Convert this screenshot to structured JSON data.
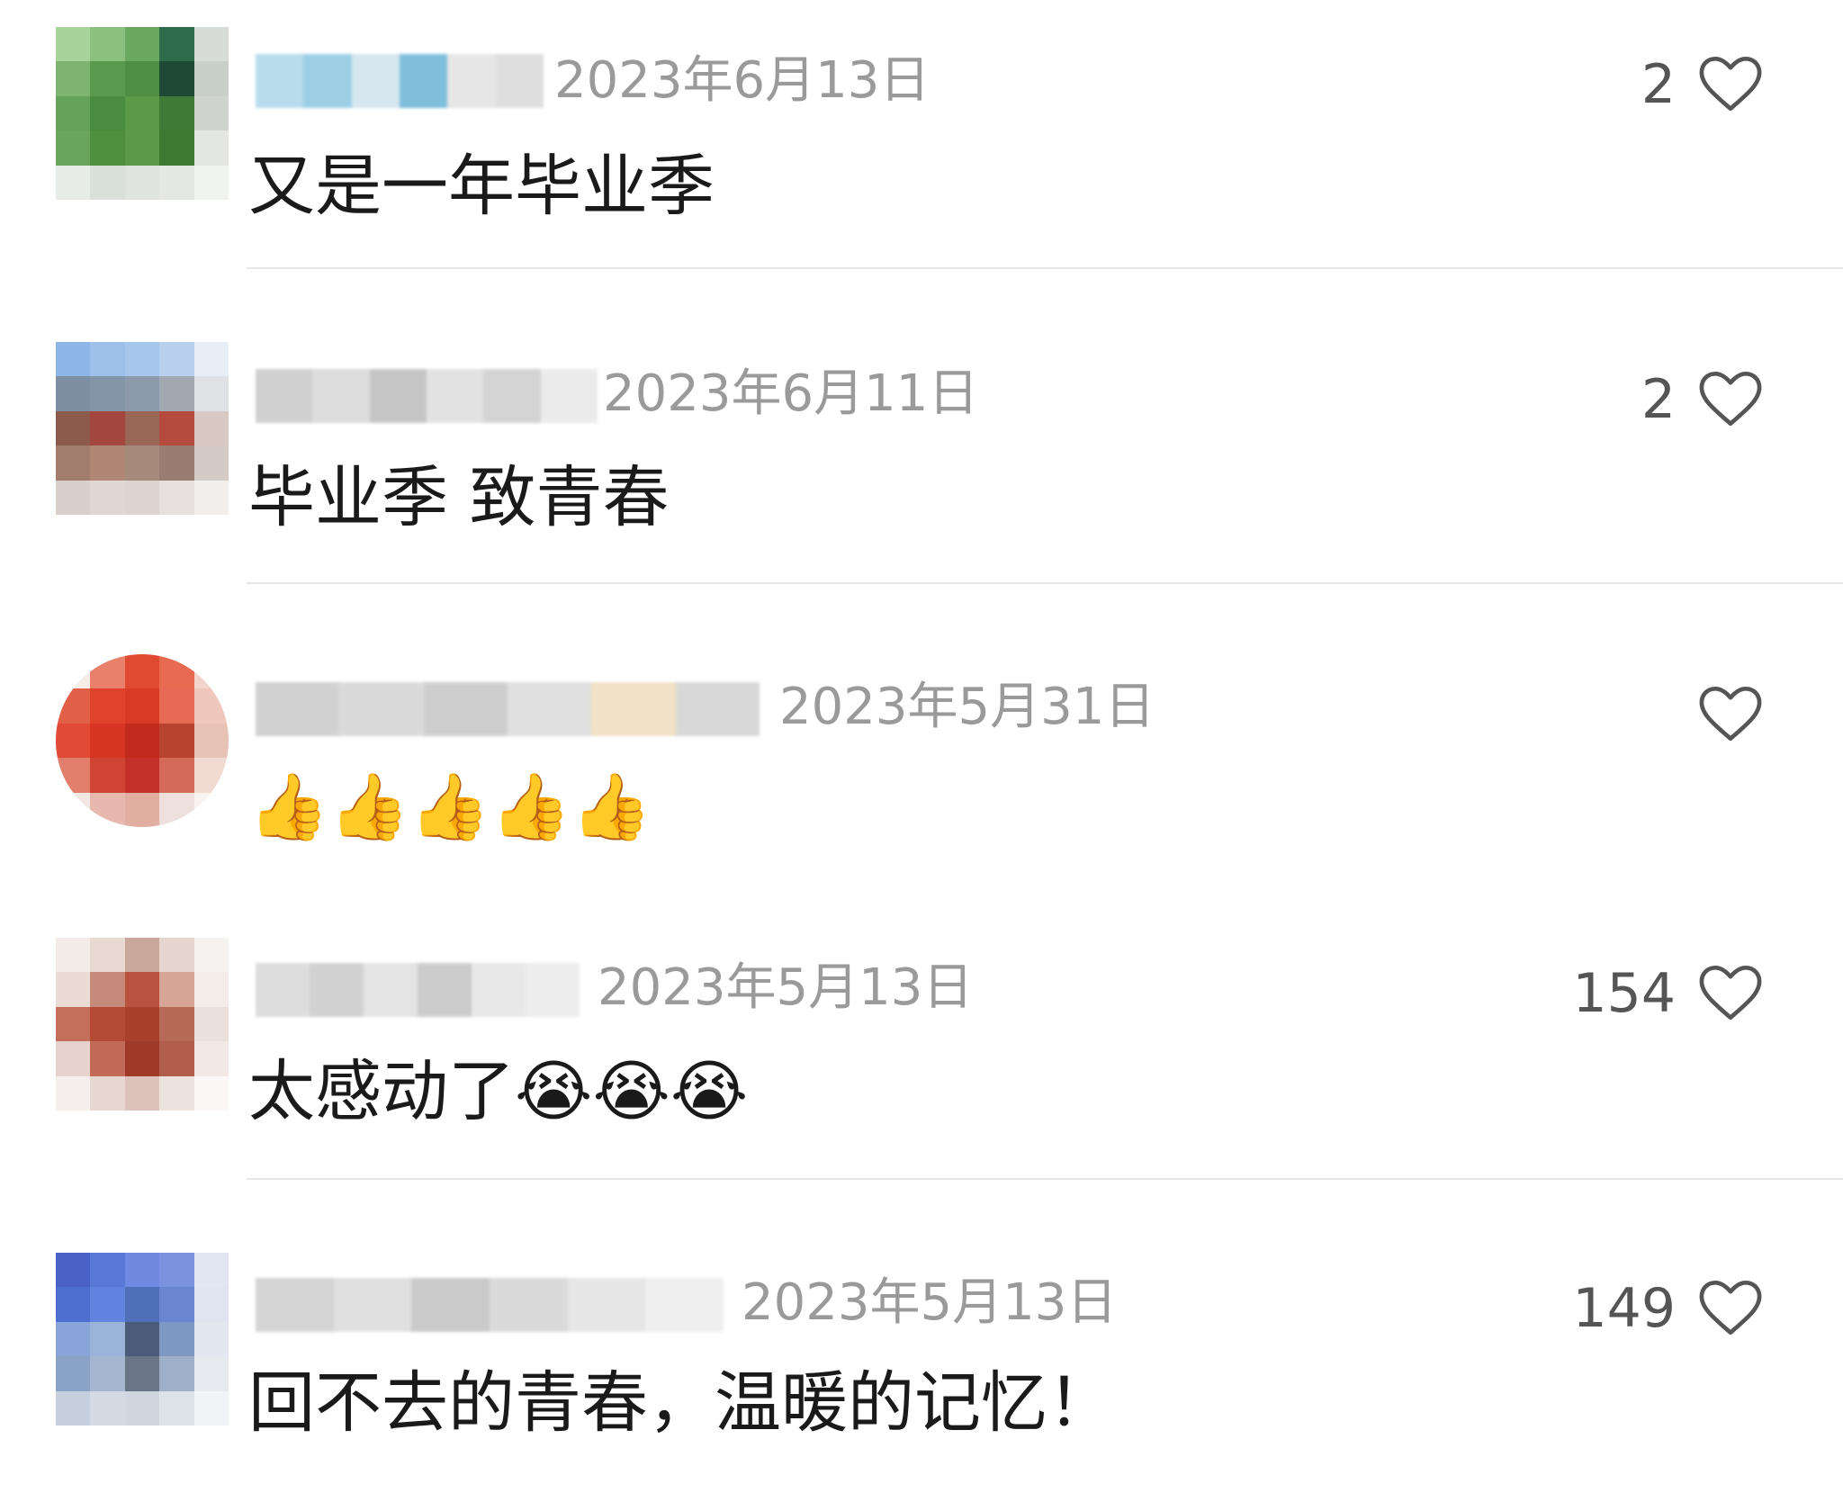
{
  "comments": [
    {
      "date": "2023年6月13日",
      "text": "又是一年毕业季",
      "likes": "2",
      "avatar_colors": [
        "#a8d39a",
        "#8cc07f",
        "#6aa860",
        "#2e6b4a",
        "#d8dcd8",
        "#7fb470",
        "#5a9a4e",
        "#4f8f45",
        "#1e4a35",
        "#c9cfc9",
        "#66a35a",
        "#4a8c3f",
        "#5a9a48",
        "#3f7a36",
        "#cfd4cf",
        "#6aa55c",
        "#4f9040",
        "#5b9a48",
        "#3b7a30",
        "#e4e6e4",
        "#e8ece8",
        "#d9dfd9",
        "#e0e4e0",
        "#e4e7e4",
        "#f0f2f0"
      ],
      "username_colors": [
        "#b7dcec",
        "#9ccfe6",
        "#d6e7ef",
        "#7fbfdc",
        "#e6e6e6",
        "#dedede"
      ]
    },
    {
      "date": "2023年6月11日",
      "text": "毕业季 致青春",
      "likes": "2",
      "avatar_colors": [
        "#8db5e6",
        "#9cc0ea",
        "#a7c6ec",
        "#b8d0ee",
        "#e8eef6",
        "#7d8fa3",
        "#8595a8",
        "#8d9aab",
        "#a1a8b2",
        "#dfe1e4",
        "#8b5a4c",
        "#a2463e",
        "#9a6656",
        "#b54a3e",
        "#d8c9c4",
        "#a27d6e",
        "#b08674",
        "#a68a7c",
        "#9a7d72",
        "#d4cbc6",
        "#d9d0cc",
        "#e0d6d2",
        "#ddd4d0",
        "#e5e0dd",
        "#f1eeec"
      ],
      "username_colors": [
        "#d0d0d0",
        "#dcdcdc",
        "#c6c6c6",
        "#e2e2e2",
        "#d4d4d4",
        "#ebebeb"
      ]
    },
    {
      "date": "2023年5月31日",
      "text": "👍👍👍👍👍",
      "likes": "",
      "avatar_colors": [
        "#f6ece8",
        "#e8806c",
        "#e04a30",
        "#e86a50",
        "#f2d6cc",
        "#e26048",
        "#e0432c",
        "#d83a26",
        "#e76a55",
        "#efc7bd",
        "#e04a36",
        "#d83424",
        "#c22a1e",
        "#b8432e",
        "#e9c2b6",
        "#e27e6c",
        "#d04434",
        "#c4302a",
        "#d66a58",
        "#f0dad2",
        "#f4e6e2",
        "#e7b9ae",
        "#e3aea2",
        "#eee0dc",
        "#f8f2f0"
      ],
      "username_colors": [
        "#d2d2d2",
        "#dadada",
        "#cecece",
        "#e0e0e0",
        "#f2e1c8",
        "#d8d8d8"
      ]
    },
    {
      "date": "2023年5月13日",
      "text": "太感动了😭😭😭",
      "likes": "154",
      "avatar_colors": [
        "#f2ebe8",
        "#e8d8d2",
        "#c9a79a",
        "#e6d5cf",
        "#f6f2f0",
        "#eadbd4",
        "#c68a7a",
        "#b9523e",
        "#d6a596",
        "#f3ece9",
        "#c46e5c",
        "#b44a36",
        "#a8402c",
        "#b86a58",
        "#ece0dc",
        "#e6d2cc",
        "#c26a58",
        "#a03a28",
        "#b25e4c",
        "#f2e9e6",
        "#f4eeec",
        "#e8d6d0",
        "#dcc2ba",
        "#ece2de",
        "#faf7f6"
      ],
      "username_colors": [
        "#dcdcdc",
        "#d2d2d2",
        "#e4e4e4",
        "#cccccc",
        "#e8e8e8",
        "#ededed"
      ]
    },
    {
      "date": "2023年5月13日",
      "text": "回不去的青春，温暖的记忆！",
      "likes": "149",
      "avatar_colors": [
        "#4a62c8",
        "#5a78d6",
        "#6f8ae0",
        "#7b93de",
        "#e1e6f2",
        "#4f6fd0",
        "#6284e0",
        "#4f6fb8",
        "#6a86d0",
        "#dfe4f0",
        "#88a4d8",
        "#9bb3d8",
        "#4a5c7a",
        "#7e98c4",
        "#e3e7ef",
        "#8aa2c6",
        "#a4b6d0",
        "#6a7688",
        "#9eb0c8",
        "#e6e9ee",
        "#c5cfde",
        "#d3dae4",
        "#cfd6df",
        "#dde2e8",
        "#f1f3f6"
      ],
      "username_colors": [
        "#d4d4d4",
        "#e0e0e0",
        "#cacaca",
        "#dadada",
        "#e6e6e6",
        "#efefef"
      ]
    }
  ]
}
